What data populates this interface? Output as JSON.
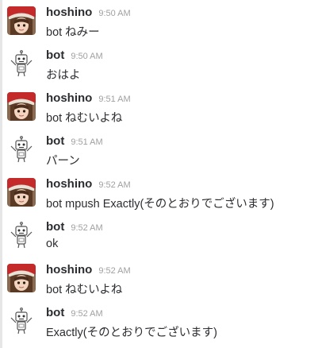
{
  "messages": [
    {
      "user": "hoshino",
      "time": "9:50 AM",
      "text": "bot ねみー",
      "avatar": "hoshino-avatar"
    },
    {
      "user": "bot",
      "time": "9:50 AM",
      "text": "おはよ",
      "avatar": "robot-avatar"
    },
    {
      "user": "hoshino",
      "time": "9:51 AM",
      "text": "bot ねむいよね",
      "avatar": "hoshino-avatar"
    },
    {
      "user": "bot",
      "time": "9:51 AM",
      "text": "パーン",
      "avatar": "robot-avatar"
    },
    {
      "user": "hoshino",
      "time": "9:52 AM",
      "text": "bot mpush Exactly(そのとおりでございます)",
      "avatar": "hoshino-avatar"
    },
    {
      "user": "bot",
      "time": "9:52 AM",
      "text": "ok",
      "avatar": "robot-avatar"
    },
    {
      "user": "hoshino",
      "time": "9:52 AM",
      "text": "bot ねむいよね",
      "avatar": "hoshino-avatar"
    },
    {
      "user": "bot",
      "time": "9:52 AM",
      "text": "Exactly(そのとおりでございます)",
      "avatar": "robot-avatar"
    }
  ],
  "colors": {
    "username": "#2c2d30",
    "timestamp": "#a0a0a2",
    "text": "#2c2d30",
    "background": "#ffffff"
  }
}
